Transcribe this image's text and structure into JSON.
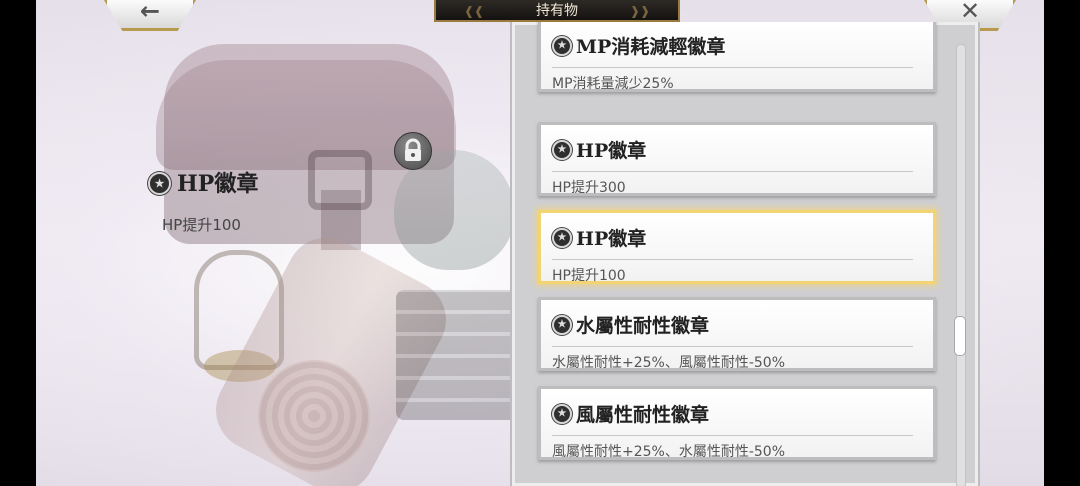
{
  "header": {
    "title": "持有物",
    "back_glyph": "←",
    "close_glyph": "✕"
  },
  "selected_item": {
    "name": "HP徽章",
    "description": "HP提升100",
    "icon": "badge-icon"
  },
  "lock": {
    "icon": "lock-icon",
    "glyph": "🔒"
  },
  "items": [
    {
      "name": "MP消耗減輕徽章",
      "description": "MP消耗量減少25%",
      "selected": false
    },
    {
      "name": "HP徽章",
      "description": "HP提升300",
      "selected": false
    },
    {
      "name": "HP徽章",
      "description": "HP提升100",
      "selected": true
    },
    {
      "name": "水屬性耐性徽章",
      "description": "水屬性耐性+25%、風屬性耐性-50%",
      "selected": false
    },
    {
      "name": "風屬性耐性徽章",
      "description": "風屬性耐性+25%、水屬性耐性-50%",
      "selected": false
    }
  ],
  "colors": {
    "selected_border": "#f2d472",
    "title_plate": "#1f1c19",
    "accent_gold": "#b89a4e"
  }
}
